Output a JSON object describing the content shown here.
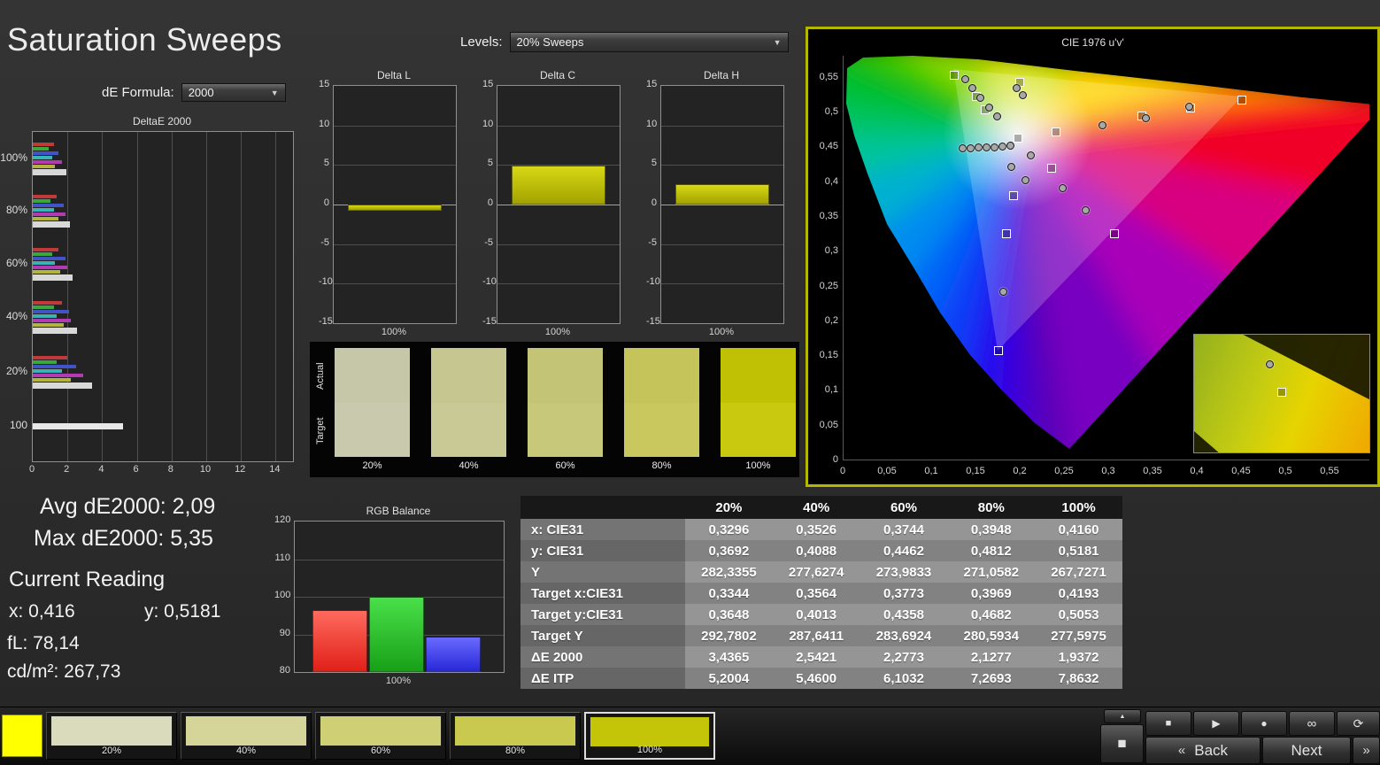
{
  "app": {
    "title": "Saturation Sweeps"
  },
  "controls": {
    "de_formula": {
      "label": "dE Formula:",
      "value": "2000"
    },
    "levels": {
      "label": "Levels:",
      "value": "20% Sweeps"
    }
  },
  "icons": {
    "chevron_down": "▼",
    "chevron_left_double": "«",
    "chevron_right_double": "»",
    "arrow_up": "▲",
    "stop": "■",
    "play": "▶",
    "record": "●",
    "loop": "∞",
    "refresh": "⟳"
  },
  "stats": {
    "avg_de2000": "Avg dE2000: 2,09",
    "max_de2000": "Max dE2000: 5,35",
    "current_reading_label": "Current Reading",
    "x_value": "x: 0,416",
    "y_value": "y: 0,5181",
    "fl_value": "fL: 78,14",
    "cdm2_value": "cd/m²: 267,73"
  },
  "chart_data": {
    "deltae2000": {
      "type": "bar",
      "title": "DeltaE 2000",
      "orientation": "horizontal",
      "xlim": [
        0,
        15
      ],
      "x_ticks": [
        0,
        2,
        4,
        6,
        8,
        10,
        12,
        14
      ],
      "groups": [
        {
          "label": "100%",
          "bars": [
            {
              "color": "#c03a3a",
              "value": 1.2
            },
            {
              "color": "#3aa83a",
              "value": 0.9
            },
            {
              "color": "#4054c8",
              "value": 1.5
            },
            {
              "color": "#38b4b4",
              "value": 1.1
            },
            {
              "color": "#b43ab4",
              "value": 1.7
            },
            {
              "color": "#b4b43a",
              "value": 1.3
            },
            {
              "color": "#d8d8d8",
              "value": 1.94,
              "wide": true
            }
          ]
        },
        {
          "label": "80%",
          "bars": [
            {
              "color": "#c03a3a",
              "value": 1.4
            },
            {
              "color": "#3aa83a",
              "value": 1.0
            },
            {
              "color": "#4054c8",
              "value": 1.8
            },
            {
              "color": "#38b4b4",
              "value": 1.2
            },
            {
              "color": "#b43ab4",
              "value": 1.9
            },
            {
              "color": "#b4b43a",
              "value": 1.5
            },
            {
              "color": "#d8d8d8",
              "value": 2.13,
              "wide": true
            }
          ]
        },
        {
          "label": "60%",
          "bars": [
            {
              "color": "#c03a3a",
              "value": 1.5
            },
            {
              "color": "#3aa83a",
              "value": 1.1
            },
            {
              "color": "#4054c8",
              "value": 1.9
            },
            {
              "color": "#38b4b4",
              "value": 1.3
            },
            {
              "color": "#b43ab4",
              "value": 2.0
            },
            {
              "color": "#b4b43a",
              "value": 1.6
            },
            {
              "color": "#d8d8d8",
              "value": 2.28,
              "wide": true
            }
          ]
        },
        {
          "label": "40%",
          "bars": [
            {
              "color": "#c03a3a",
              "value": 1.7
            },
            {
              "color": "#3aa83a",
              "value": 1.2
            },
            {
              "color": "#4054c8",
              "value": 2.1
            },
            {
              "color": "#38b4b4",
              "value": 1.4
            },
            {
              "color": "#b43ab4",
              "value": 2.2
            },
            {
              "color": "#b4b43a",
              "value": 1.8
            },
            {
              "color": "#d8d8d8",
              "value": 2.54,
              "wide": true
            }
          ]
        },
        {
          "label": "20%",
          "bars": [
            {
              "color": "#c03a3a",
              "value": 2.0
            },
            {
              "color": "#3aa83a",
              "value": 1.4
            },
            {
              "color": "#4054c8",
              "value": 2.5
            },
            {
              "color": "#38b4b4",
              "value": 1.7
            },
            {
              "color": "#b43ab4",
              "value": 2.9
            },
            {
              "color": "#b4b43a",
              "value": 2.2
            },
            {
              "color": "#d8d8d8",
              "value": 3.44,
              "wide": true
            }
          ]
        },
        {
          "label": "100",
          "bars": [
            {
              "color": "#e8e8e8",
              "value": 5.2,
              "wide": true
            }
          ]
        }
      ]
    },
    "delta_l": {
      "type": "bar",
      "title": "Delta L",
      "ylim": [
        -15,
        15
      ],
      "y_ticks": [
        15,
        10,
        5,
        0,
        -5,
        -10,
        -15
      ],
      "categories": [
        "100%"
      ],
      "values": [
        -0.8
      ]
    },
    "delta_c": {
      "type": "bar",
      "title": "Delta C",
      "ylim": [
        -15,
        15
      ],
      "y_ticks": [
        15,
        10,
        5,
        0,
        -5,
        -10,
        -15
      ],
      "categories": [
        "100%"
      ],
      "values": [
        4.9
      ]
    },
    "delta_h": {
      "type": "bar",
      "title": "Delta H",
      "ylim": [
        -15,
        15
      ],
      "y_ticks": [
        15,
        10,
        5,
        0,
        -5,
        -10,
        -15
      ],
      "categories": [
        "100%"
      ],
      "values": [
        2.6
      ]
    },
    "rgb_balance": {
      "type": "bar",
      "title": "RGB Balance",
      "x_label": "100%",
      "ylim": [
        80,
        120
      ],
      "y_ticks": [
        120,
        110,
        100,
        90,
        80
      ],
      "categories": [
        "Red",
        "Green",
        "Blue"
      ],
      "values": [
        96.5,
        100,
        89.5
      ],
      "colors": [
        "#e02018",
        "#18a018",
        "#2828d8"
      ],
      "colors_light": [
        "#ff6a5e",
        "#4ae04a",
        "#6a6aff"
      ]
    },
    "cie": {
      "type": "scatter",
      "title": "CIE 1976 u'v'",
      "border_color": "#b6b600",
      "x_ticks": [
        "0",
        "0,05",
        "0,1",
        "0,15",
        "0,2",
        "0,25",
        "0,3",
        "0,35",
        "0,4",
        "0,45",
        "0,5",
        "0,55"
      ],
      "y_ticks": [
        "0",
        "0,05",
        "0,1",
        "0,15",
        "0,2",
        "0,25",
        "0,3",
        "0,35",
        "0,4",
        "0,45",
        "0,5",
        "0,55"
      ],
      "targets_uv": [
        [
          0.126,
          0.553
        ],
        [
          0.151,
          0.523
        ],
        [
          0.161,
          0.504
        ],
        [
          0.2,
          0.543
        ],
        [
          0.241,
          0.472
        ],
        [
          0.198,
          0.463
        ],
        [
          0.236,
          0.42
        ],
        [
          0.193,
          0.38
        ],
        [
          0.185,
          0.326
        ],
        [
          0.307,
          0.326
        ],
        [
          0.176,
          0.158
        ],
        [
          0.338,
          0.495
        ],
        [
          0.393,
          0.506
        ],
        [
          0.451,
          0.518
        ]
      ],
      "measured_uv": [
        [
          0.138,
          0.548
        ],
        [
          0.146,
          0.536
        ],
        [
          0.155,
          0.522
        ],
        [
          0.165,
          0.508
        ],
        [
          0.174,
          0.495
        ],
        [
          0.196,
          0.536
        ],
        [
          0.203,
          0.525
        ],
        [
          0.135,
          0.449
        ],
        [
          0.144,
          0.449
        ],
        [
          0.153,
          0.45
        ],
        [
          0.162,
          0.45
        ],
        [
          0.171,
          0.451
        ],
        [
          0.18,
          0.452
        ],
        [
          0.189,
          0.453
        ],
        [
          0.212,
          0.439
        ],
        [
          0.19,
          0.422
        ],
        [
          0.206,
          0.403
        ],
        [
          0.248,
          0.392
        ],
        [
          0.274,
          0.36
        ],
        [
          0.181,
          0.243
        ],
        [
          0.293,
          0.482
        ],
        [
          0.342,
          0.492
        ],
        [
          0.391,
          0.509
        ]
      ],
      "inset": {
        "circle": [
          0.43,
          0.25
        ],
        "square": [
          0.5,
          0.49
        ]
      }
    }
  },
  "swatch_panel": {
    "actual_label": "Actual",
    "target_label": "Target",
    "items": [
      {
        "label": "20%",
        "actual": "#c6c6a8",
        "target": "#c9c9ad"
      },
      {
        "label": "40%",
        "actual": "#c6c691",
        "target": "#c9c996"
      },
      {
        "label": "60%",
        "actual": "#c4c476",
        "target": "#c8c87b"
      },
      {
        "label": "80%",
        "actual": "#c4c45a",
        "target": "#c8c85f"
      },
      {
        "label": "100%",
        "actual": "#c0c004",
        "target": "#c9c90f"
      }
    ]
  },
  "table": {
    "header": [
      "",
      "20%",
      "40%",
      "60%",
      "80%",
      "100%"
    ],
    "rows": [
      {
        "label": "x: CIE31",
        "values": [
          "0,3296",
          "0,3526",
          "0,3744",
          "0,3948",
          "0,4160"
        ]
      },
      {
        "label": "y: CIE31",
        "values": [
          "0,3692",
          "0,4088",
          "0,4462",
          "0,4812",
          "0,5181"
        ]
      },
      {
        "label": "Y",
        "values": [
          "282,3355",
          "277,6274",
          "273,9833",
          "271,0582",
          "267,7271"
        ]
      },
      {
        "label": "Target x:CIE31",
        "values": [
          "0,3344",
          "0,3564",
          "0,3773",
          "0,3969",
          "0,4193"
        ]
      },
      {
        "label": "Target y:CIE31",
        "values": [
          "0,3648",
          "0,4013",
          "0,4358",
          "0,4682",
          "0,5053"
        ]
      },
      {
        "label": "Target Y",
        "values": [
          "292,7802",
          "287,6411",
          "283,6924",
          "280,5934",
          "277,5975"
        ]
      },
      {
        "label": "ΔE 2000",
        "values": [
          "3,4365",
          "2,5421",
          "2,2773",
          "2,1277",
          "1,9372"
        ]
      },
      {
        "label": "ΔE ITP",
        "values": [
          "5,2004",
          "5,4600",
          "6,1032",
          "7,2693",
          "7,8632"
        ]
      }
    ]
  },
  "bottom_bar": {
    "active_color": "#ffff00",
    "swatches": [
      {
        "label": "20%",
        "color": "#dadabd"
      },
      {
        "label": "40%",
        "color": "#d5d599"
      },
      {
        "label": "60%",
        "color": "#cfcf76"
      },
      {
        "label": "80%",
        "color": "#c9c950"
      },
      {
        "label": "100%",
        "color": "#c4c408",
        "selected": true
      }
    ],
    "back_label": "Back",
    "next_label": "Next"
  }
}
